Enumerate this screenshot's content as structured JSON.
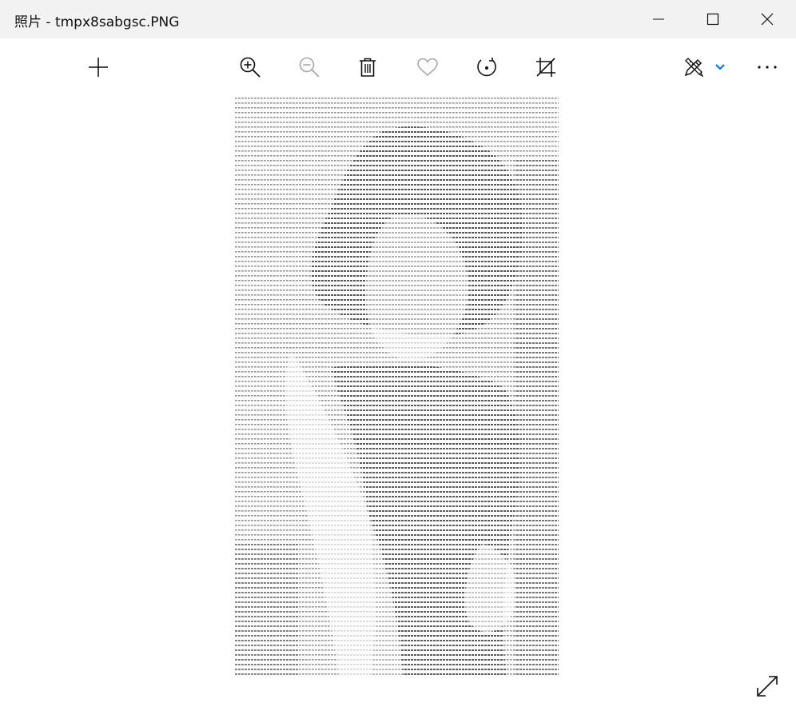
{
  "window": {
    "title": "照片 - tmpx8sabgsc.PNG",
    "controls": [
      "minimize-icon",
      "maximize-icon",
      "close-icon"
    ]
  },
  "toolbar": {
    "accent": "#0078d7",
    "left": [
      "gallery-icon",
      "add-icon"
    ],
    "center": [
      "zoom-in-icon",
      "zoom-out-icon",
      "delete-icon",
      "favorite-icon",
      "rotate-icon",
      "crop-icon"
    ],
    "right": [
      "edit-create-icon",
      "chevron-down-icon",
      "more-icon"
    ],
    "disabled": [
      "zoom-out-icon",
      "favorite-icon"
    ]
  },
  "viewer": {
    "image_description_icon": "ascii-art-photo",
    "expand_icon": "full-screen-icon"
  }
}
